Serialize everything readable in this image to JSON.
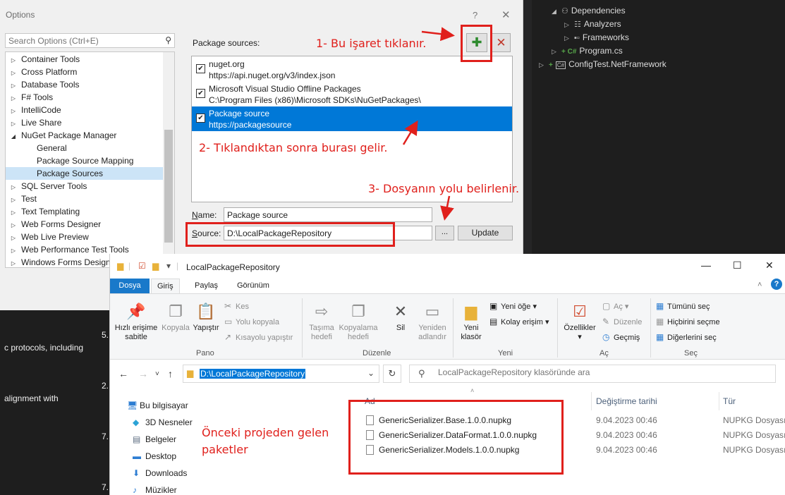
{
  "solution_explorer": {
    "items": [
      {
        "label": "Dependencies",
        "kind": "dependencies"
      },
      {
        "label": "Analyzers",
        "kind": "analyzers"
      },
      {
        "label": "Frameworks",
        "kind": "frameworks"
      },
      {
        "label": "Program.cs",
        "prefix": "+ C#",
        "kind": "file"
      },
      {
        "label": "ConfigTest.NetFramework",
        "prefix": "+",
        "kind": "project"
      }
    ]
  },
  "doc_fragments": [
    "c protocols, including",
    "5.",
    "2.",
    "alignment with",
    "7.",
    "7."
  ],
  "options": {
    "title": "Options",
    "help": "?",
    "close": "✕",
    "search_placeholder": "Search Options (Ctrl+E)",
    "tree": [
      {
        "label": "Container Tools",
        "expander": "▷",
        "indent": 0
      },
      {
        "label": "Cross Platform",
        "expander": "▷",
        "indent": 0
      },
      {
        "label": "Database Tools",
        "expander": "▷",
        "indent": 0
      },
      {
        "label": "F# Tools",
        "expander": "▷",
        "indent": 0
      },
      {
        "label": "IntelliCode",
        "expander": "▷",
        "indent": 0
      },
      {
        "label": "Live Share",
        "expander": "▷",
        "indent": 0
      },
      {
        "label": "NuGet Package Manager",
        "expander": "◢",
        "indent": 0
      },
      {
        "label": "General",
        "expander": "",
        "indent": 1
      },
      {
        "label": "Package Source Mapping",
        "expander": "",
        "indent": 1
      },
      {
        "label": "Package Sources",
        "expander": "",
        "indent": 1,
        "selected": true
      },
      {
        "label": "SQL Server Tools",
        "expander": "▷",
        "indent": 0
      },
      {
        "label": "Test",
        "expander": "▷",
        "indent": 0
      },
      {
        "label": "Text Templating",
        "expander": "▷",
        "indent": 0
      },
      {
        "label": "Web Forms Designer",
        "expander": "▷",
        "indent": 0
      },
      {
        "label": "Web Live Preview",
        "expander": "▷",
        "indent": 0
      },
      {
        "label": "Web Performance Test Tools",
        "expander": "▷",
        "indent": 0
      },
      {
        "label": "Windows Forms Designer",
        "expander": "▷",
        "indent": 0
      }
    ],
    "package_sources_label": "Package sources:",
    "add_symbol": "✚",
    "remove_symbol": "✕",
    "sources": [
      {
        "name": "nuget.org",
        "url": "https://api.nuget.org/v3/index.json",
        "checked": true,
        "selected": false
      },
      {
        "name": "Microsoft Visual Studio Offline Packages",
        "url": "C:\\Program Files (x86)\\Microsoft SDKs\\NuGetPackages\\",
        "checked": true,
        "selected": false
      },
      {
        "name": "Package source",
        "url": "https://packagesource",
        "checked": true,
        "selected": true
      }
    ],
    "name_label_key": "N",
    "name_label_rest": "ame:",
    "name_value": "Package source",
    "source_label_key": "S",
    "source_label_rest": "ource:",
    "source_value": "D:\\LocalPackageRepository",
    "browse_label": "...",
    "update_label": "Update"
  },
  "annotations": {
    "step1": "1- Bu işaret tıklanır.",
    "step2": "2- Tıklandıktan sonra burası gelir.",
    "step3": "3- Dosyanın yolu belirlenir.",
    "note": "Önceki projeden gelen",
    "note2": "paketler",
    "color": "#e0201c"
  },
  "explorer": {
    "title": "LocalPackageRepository",
    "window_controls": {
      "minimize": "—",
      "maximize": "☐",
      "close": "✕"
    },
    "tabs": {
      "file": "Dosya",
      "home": "Giriş",
      "share": "Paylaş",
      "view": "Görünüm"
    },
    "ribbon": {
      "pin": "Hızlı erişime sabitle",
      "pin_l1": "Hızlı erişime",
      "pin_l2": "sabitle",
      "copy": "Kopyala",
      "paste": "Yapıştır",
      "cut": "Kes",
      "copy_path": "Yolu kopyala",
      "paste_shortcut": "Kısayolu yapıştır",
      "clipboard_group": "Pano",
      "move_l1": "Taşıma",
      "move_l2": "hedefi",
      "copyto_l1": "Kopyalama",
      "copyto_l2": "hedefi",
      "delete": "Sil",
      "rename_l1": "Yeniden",
      "rename_l2": "adlandır",
      "organize_group": "Düzenle",
      "new_folder_l1": "Yeni",
      "new_folder_l2": "klasör",
      "new_item": "Yeni öğe",
      "easy_access": "Kolay erişim",
      "new_group": "Yeni",
      "properties": "Özellikler",
      "open": "Aç",
      "edit": "Düzenle",
      "history": "Geçmiş",
      "open_group": "Aç",
      "select_all": "Tümünü seç",
      "select_none": "Hiçbirini seçme",
      "invert": "Diğerlerini seç",
      "select_group": "Seç"
    },
    "address": "D:\\LocalPackageRepository",
    "search_placeholder": "LocalPackageRepository klasöründe ara",
    "nav": [
      {
        "label": "Bu bilgisayar",
        "icon": "computer-icon",
        "glyph": "🖥"
      },
      {
        "label": "3D Nesneler",
        "icon": "3d-objects-icon",
        "glyph": "◆"
      },
      {
        "label": "Belgeler",
        "icon": "documents-icon",
        "glyph": "▤"
      },
      {
        "label": "Desktop",
        "icon": "desktop-icon",
        "glyph": "▬"
      },
      {
        "label": "Downloads",
        "icon": "downloads-icon",
        "glyph": "⬇"
      },
      {
        "label": "Müzikler",
        "icon": "music-icon",
        "glyph": "♪"
      }
    ],
    "columns": {
      "name": "Ad",
      "date": "Değiştirme tarihi",
      "type": "Tür"
    },
    "files": [
      {
        "name": "GenericSerializer.Base.1.0.0.nupkg",
        "date": "9.04.2023 00:46",
        "type": "NUPKG Dosyası"
      },
      {
        "name": "GenericSerializer.DataFormat.1.0.0.nupkg",
        "date": "9.04.2023 00:46",
        "type": "NUPKG Dosyası"
      },
      {
        "name": "GenericSerializer.Models.1.0.0.nupkg",
        "date": "9.04.2023 00:46",
        "type": "NUPKG Dosyası"
      }
    ]
  }
}
